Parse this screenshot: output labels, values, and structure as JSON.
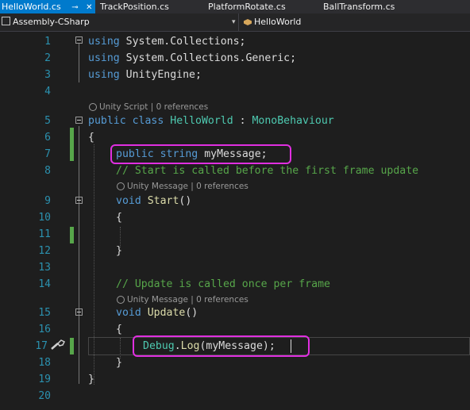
{
  "tabs": [
    {
      "label": "HelloWorld.cs",
      "pin": "⊸",
      "close": "✕"
    },
    {
      "label": "TrackPosition.cs"
    },
    {
      "label": "PlatformRotate.cs"
    },
    {
      "label": "BallTransform.cs"
    }
  ],
  "nav": {
    "project": "Assembly-CSharp",
    "member": "HelloWorld",
    "arrow": "▾"
  },
  "lines": {
    "n1": "1",
    "n2": "2",
    "n3": "3",
    "n4": "4",
    "n5": "5",
    "n6": "6",
    "n7": "7",
    "n8": "8",
    "n9": "9",
    "n10": "10",
    "n11": "11",
    "n12": "12",
    "n13": "13",
    "n14": "14",
    "n15": "15",
    "n16": "16",
    "n17": "17",
    "n18": "18",
    "n19": "19",
    "n20": "20"
  },
  "code": {
    "using": "using",
    "ns1": " System.Collections;",
    "ns2": " System.Collections.Generic;",
    "ns3": " UnityEngine;",
    "public": "public",
    "class": "class",
    "className": "HelloWorld",
    "colon": " : ",
    "base": "MonoBehaviour",
    "open6": "{",
    "string": "string",
    "field": "myMessage",
    "semi": ";",
    "comment8": "// Start is called before the first frame update",
    "void": "void",
    "start": "Start",
    "parens": "()",
    "open10": "{",
    "close12": "}",
    "comment14": "// Update is called once per frame",
    "update": "Update",
    "open16": "{",
    "debug": "Debug",
    "dot": ".",
    "log": "Log",
    "arg": "(myMessage);",
    "close18": "}",
    "close19": "}"
  },
  "codelens": {
    "class_lens": "Unity Script | 0 references",
    "start_lens": "Unity Message | 0 references",
    "update_lens": "Unity Message | 0 references"
  },
  "colors": {
    "accent": "#007acc",
    "highlight": "#e02fe0",
    "keyword": "#569cd6",
    "type": "#4ec9b0",
    "comment": "#57a64a"
  },
  "icons": {
    "gutter_line17": "screwdriver-icon"
  }
}
